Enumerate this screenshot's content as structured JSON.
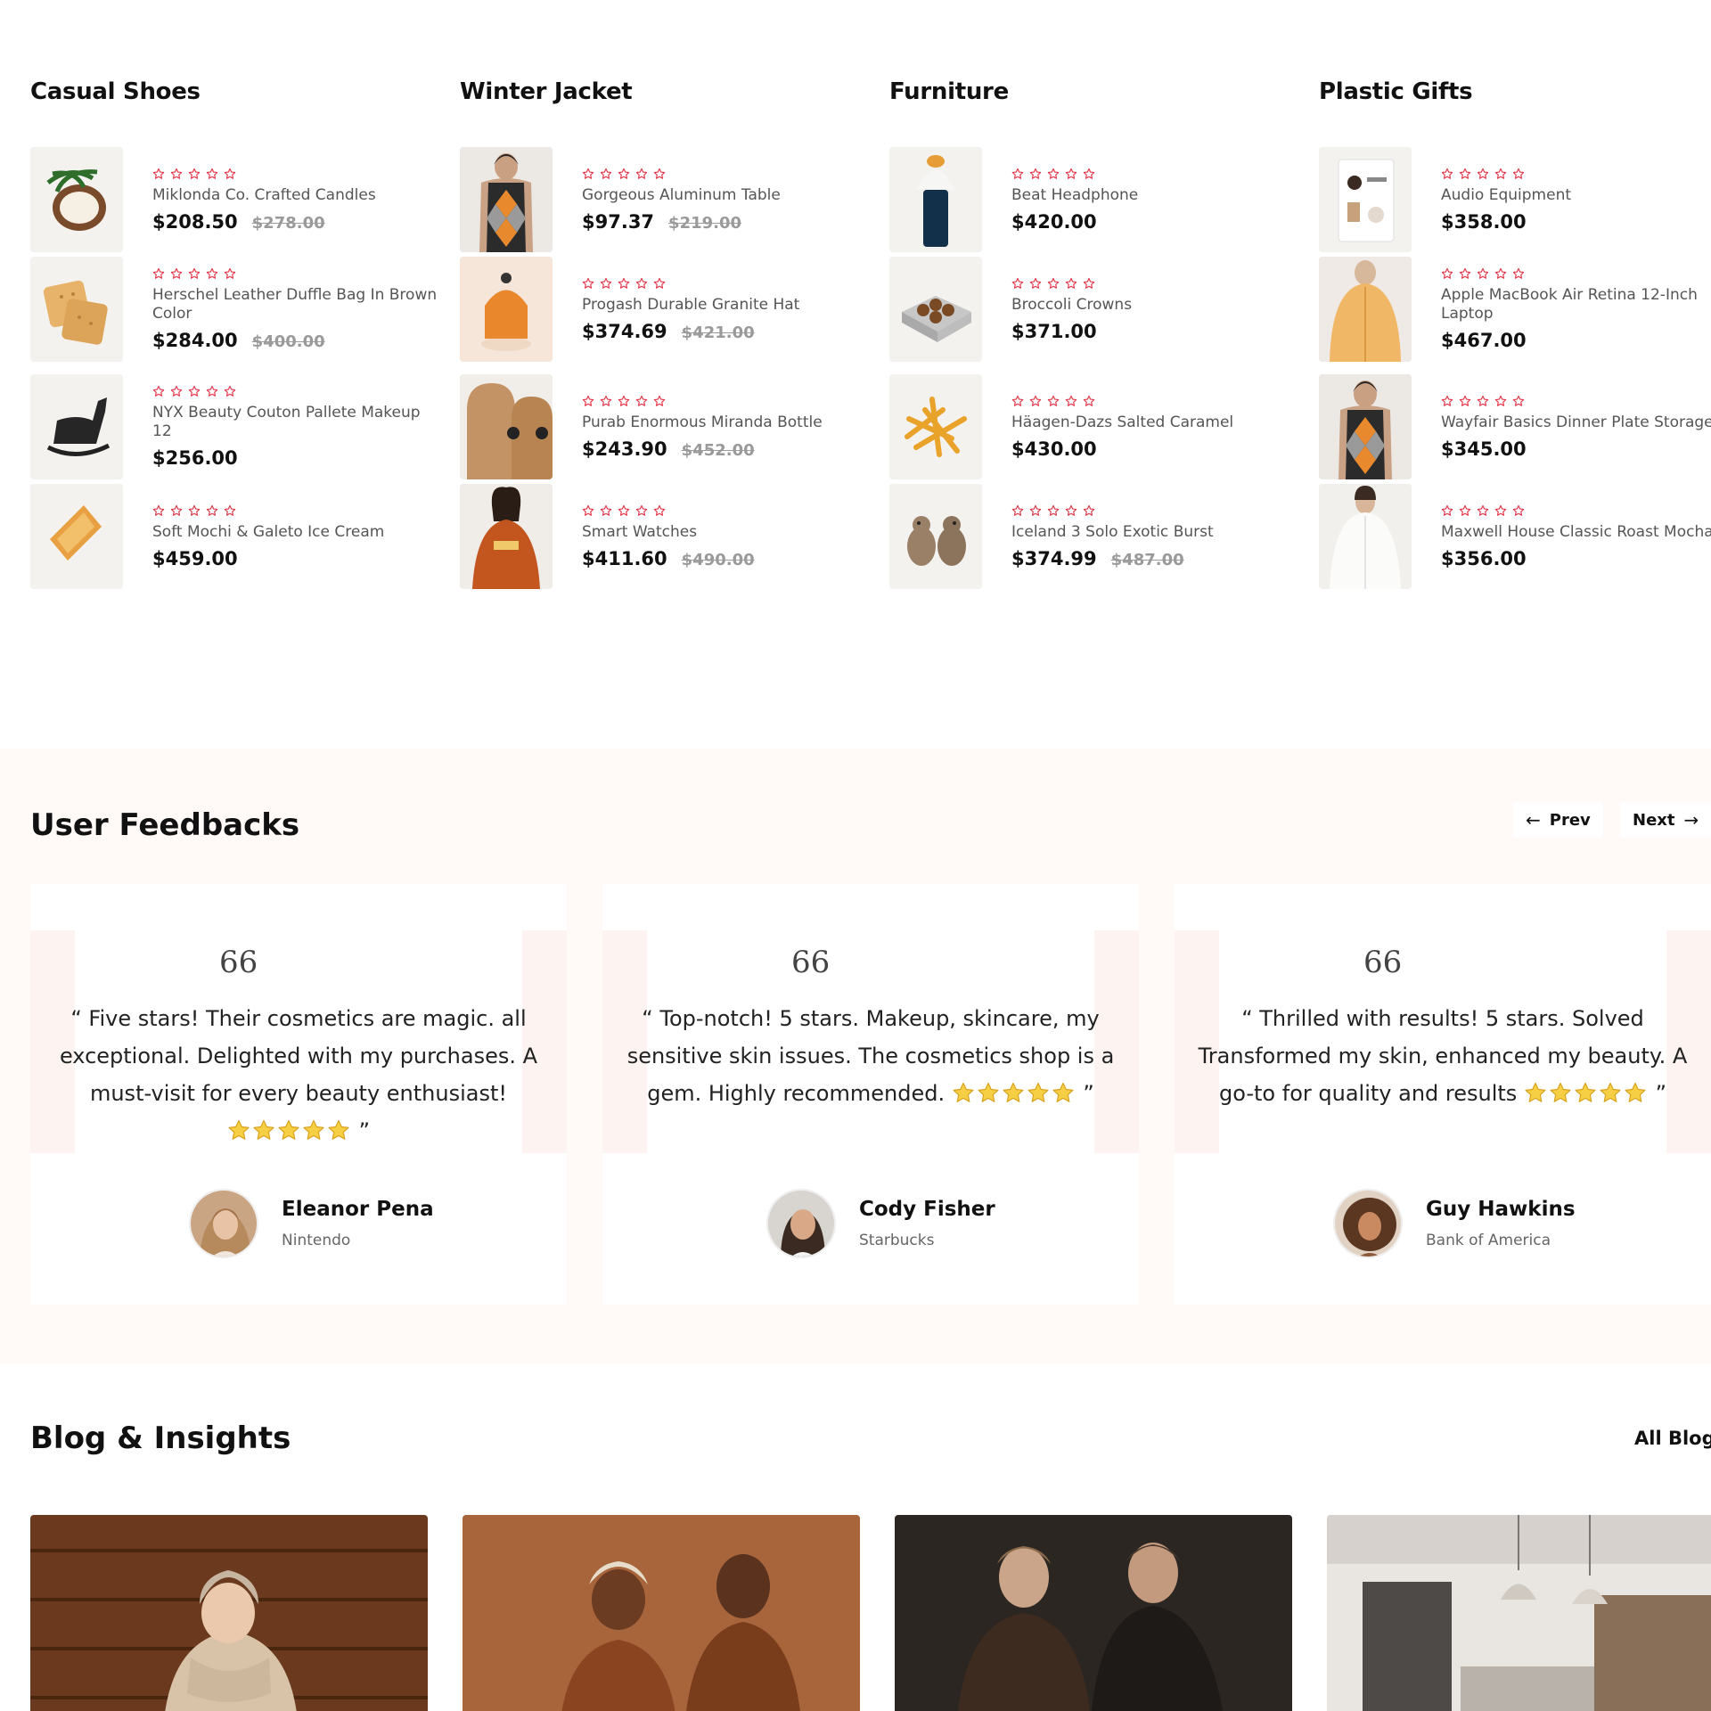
{
  "columns": [
    {
      "title": "Casual Shoes",
      "products": [
        {
          "name": "Miklonda Co. Crafted Candles",
          "price": "$208.50",
          "old_price": "$278.00",
          "rating": 5,
          "image": "coconut"
        },
        {
          "name": "Herschel Leather Duffle Bag In Brown Color",
          "price": "$284.00",
          "old_price": "$400.00",
          "rating": 5,
          "image": "crackers"
        },
        {
          "name": "NYX Beauty Couton Pallete Makeup 12",
          "price": "$256.00",
          "old_price": "",
          "rating": 5,
          "image": "rocking-horse"
        },
        {
          "name": "Soft Mochi & Galeto Ice Cream",
          "price": "$459.00",
          "old_price": "",
          "rating": 5,
          "image": "pastry"
        }
      ]
    },
    {
      "title": "Winter Jacket",
      "products": [
        {
          "name": "Gorgeous Aluminum Table",
          "price": "$97.37",
          "old_price": "$219.00",
          "rating": 5,
          "image": "argyle-vest"
        },
        {
          "name": "Progash Durable Granite Hat",
          "price": "$374.69",
          "old_price": "$421.00",
          "rating": 5,
          "image": "orange-lamp"
        },
        {
          "name": "Purab Enormous Miranda Bottle",
          "price": "$243.90",
          "old_price": "$452.00",
          "rating": 5,
          "image": "wood-speakers"
        },
        {
          "name": "Smart Watches",
          "price": "$411.60",
          "old_price": "$490.00",
          "rating": 5,
          "image": "orange-sweatshirt"
        }
      ]
    },
    {
      "title": "Furniture",
      "products": [
        {
          "name": "Beat Headphone",
          "price": "$420.00",
          "old_price": "",
          "rating": 5,
          "image": "lantern"
        },
        {
          "name": "Broccoli Crowns",
          "price": "$371.00",
          "old_price": "",
          "rating": 5,
          "image": "chocolate-box"
        },
        {
          "name": "Häagen-Dazs Salted Caramel",
          "price": "$430.00",
          "old_price": "",
          "rating": 5,
          "image": "fries"
        },
        {
          "name": "Iceland 3 Solo Exotic Burst",
          "price": "$374.99",
          "old_price": "$487.00",
          "rating": 5,
          "image": "wood-birds"
        }
      ]
    },
    {
      "title": "Plastic Gifts",
      "products": [
        {
          "name": "Audio Equipment",
          "price": "$358.00",
          "old_price": "",
          "rating": 5,
          "image": "notebook"
        },
        {
          "name": "Apple MacBook Air Retina 12-Inch Laptop",
          "price": "$467.00",
          "old_price": "",
          "rating": 5,
          "image": "yellow-jacket"
        },
        {
          "name": "Wayfair Basics Dinner Plate Storage",
          "price": "$345.00",
          "old_price": "",
          "rating": 5,
          "image": "argyle-vest"
        },
        {
          "name": "Maxwell House Classic Roast Mocha",
          "price": "$356.00",
          "old_price": "",
          "rating": 5,
          "image": "white-shirt"
        }
      ]
    }
  ],
  "feedback": {
    "title": "User Feedbacks",
    "prev_label": "Prev",
    "next_label": "Next",
    "quote_icon": "66",
    "testimonials": [
      {
        "text_before": "“ Five stars! Their cosmetics are magic. all exceptional. Delighted with my purchases. A must-visit for every beauty enthusiast!",
        "text_after": " ”",
        "name": "Eleanor Pena",
        "company": "Nintendo"
      },
      {
        "text_before": "“ Top-notch! 5 stars. Makeup, skincare, my sensitive skin issues. The cosmetics shop is a gem. Highly recommended.",
        "text_after": " ”",
        "name": "Cody Fisher",
        "company": "Starbucks"
      },
      {
        "text_before": "“ Thrilled with results! 5 stars. Solved Transformed my skin, enhanced my beauty. A go-to for quality and results",
        "text_after": " ”",
        "name": "Guy Hawkins",
        "company": "Bank of America"
      }
    ]
  },
  "blog": {
    "title": "Blog & Insights",
    "all_label": "All Blog →"
  },
  "colors": {
    "star_outline": "#e0384b",
    "feedback_bg": "#fff9f8",
    "text": "#111111",
    "muted": "#9a9a9a"
  }
}
